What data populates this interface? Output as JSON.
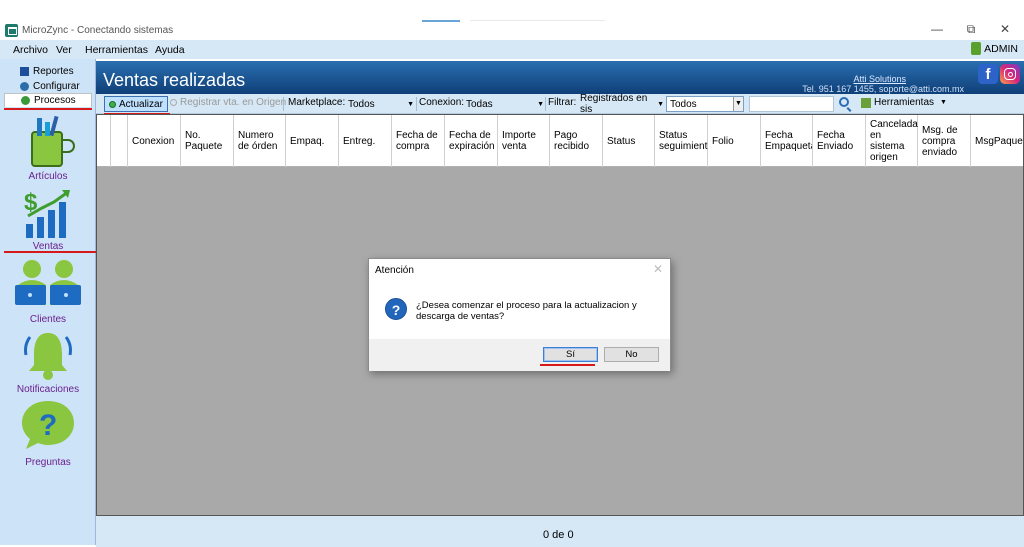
{
  "window": {
    "title": "MicroZync - Conectando sistemas",
    "minimize": "—",
    "restore": "⧉",
    "close": "✕"
  },
  "menu": {
    "items": [
      "Archivo",
      "Ver",
      "Herramientas",
      "Ayuda"
    ],
    "user": "ADMIN"
  },
  "sidebar": {
    "tabs": [
      "Reportes",
      "Configurar",
      "Procesos"
    ],
    "modules": [
      "Artículos",
      "Ventas",
      "Clientes",
      "Notificaciones",
      "Preguntas"
    ]
  },
  "header": {
    "title": "Ventas realizadas",
    "company": "Atti Solutions",
    "contact": "Tel. 951 167 1455, soporte@atti.com.mx",
    "facebook": "f"
  },
  "toolbar": {
    "actualizar": "Actualizar",
    "registrar": "Registrar vta. en Origen",
    "marketplace_label": "Marketplace:",
    "marketplace_value": "Todos",
    "conexion_label": "Conexion:",
    "conexion_value": "Todas",
    "filtrar_label": "Filtrar:",
    "filtrar_value": "Registrados en sis",
    "filtrar_sub": "Todos",
    "herramientas": "Herramientas"
  },
  "table": {
    "columns": [
      "Conexion",
      "No.\nPaquete",
      "Numero\nde órden",
      "Empaq.",
      "Entreg.",
      "Fecha de\ncompra",
      "Fecha de\nexpiración",
      "Importe\nventa",
      "Pago\nrecibido",
      "Status",
      "Status\nseguimient",
      "Folio",
      "Fecha\nEmpaqueta",
      "Fecha\nEnviado",
      "Cancelada\nen\nsistema\norigen",
      "Msg. de\ncompra\nenviado",
      "MsgPaquet"
    ]
  },
  "footer": {
    "count": "0 de 0"
  },
  "dialog": {
    "title": "Atención",
    "message": "¿Desea comenzar el proceso para la actualizacion y descarga de ventas?",
    "yes": "Sí",
    "no": "No",
    "icon": "?"
  }
}
